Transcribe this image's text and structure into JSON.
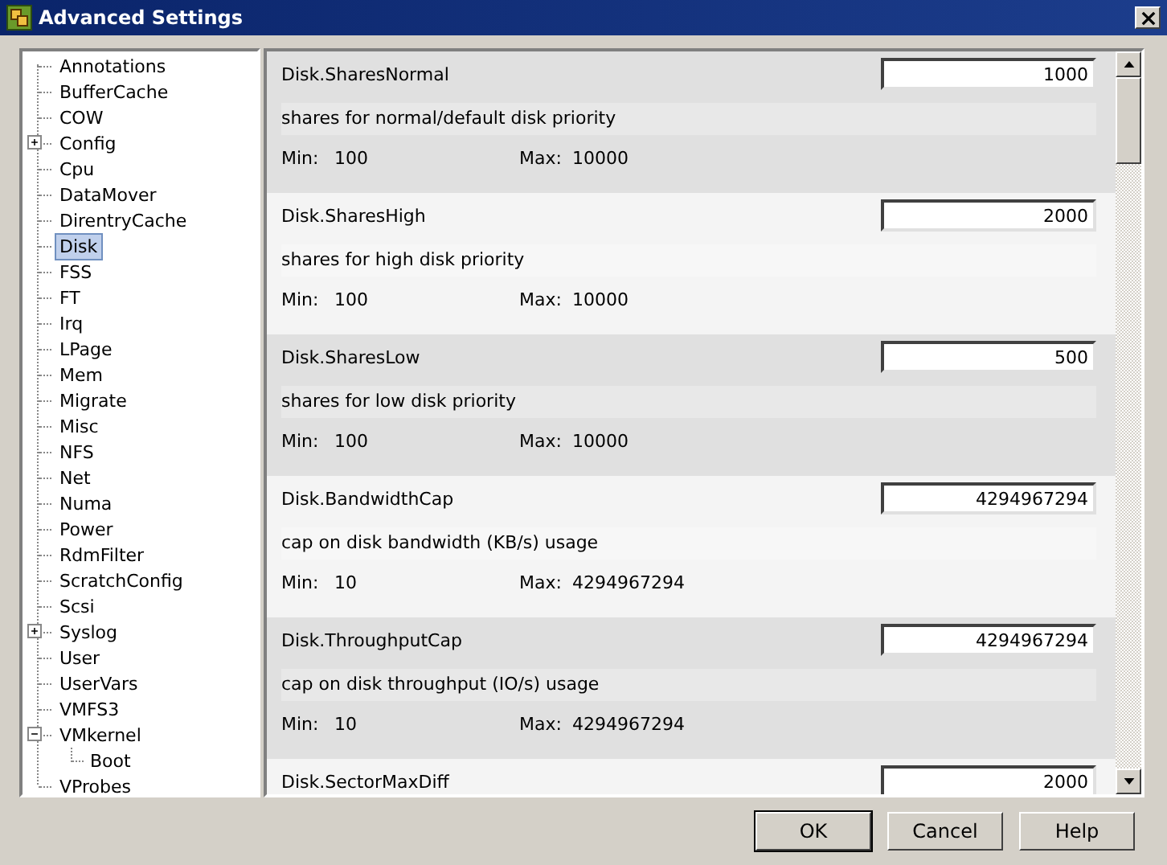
{
  "window": {
    "title": "Advanced Settings"
  },
  "tree": [
    {
      "label": "Annotations",
      "selected": false
    },
    {
      "label": "BufferCache",
      "selected": false
    },
    {
      "label": "COW",
      "selected": false
    },
    {
      "label": "Config",
      "selected": false,
      "expanded": false
    },
    {
      "label": "Cpu",
      "selected": false
    },
    {
      "label": "DataMover",
      "selected": false
    },
    {
      "label": "DirentryCache",
      "selected": false
    },
    {
      "label": "Disk",
      "selected": true
    },
    {
      "label": "FSS",
      "selected": false
    },
    {
      "label": "FT",
      "selected": false
    },
    {
      "label": "Irq",
      "selected": false
    },
    {
      "label": "LPage",
      "selected": false
    },
    {
      "label": "Mem",
      "selected": false
    },
    {
      "label": "Migrate",
      "selected": false
    },
    {
      "label": "Misc",
      "selected": false
    },
    {
      "label": "NFS",
      "selected": false
    },
    {
      "label": "Net",
      "selected": false
    },
    {
      "label": "Numa",
      "selected": false
    },
    {
      "label": "Power",
      "selected": false
    },
    {
      "label": "RdmFilter",
      "selected": false
    },
    {
      "label": "ScratchConfig",
      "selected": false
    },
    {
      "label": "Scsi",
      "selected": false
    },
    {
      "label": "Syslog",
      "selected": false,
      "expanded": false
    },
    {
      "label": "User",
      "selected": false
    },
    {
      "label": "UserVars",
      "selected": false
    },
    {
      "label": "VMFS3",
      "selected": false
    },
    {
      "label": "VMkernel",
      "selected": false,
      "expanded": true,
      "children": [
        {
          "label": "Boot",
          "selected": false
        }
      ]
    },
    {
      "label": "VProbes",
      "selected": false
    }
  ],
  "settings": [
    {
      "name": "Disk.SharesNormal",
      "value": "1000",
      "description": "shares for normal/default disk priority",
      "min_label": "Min:",
      "min": "100",
      "max_label": "Max:",
      "max": "10000"
    },
    {
      "name": "Disk.SharesHigh",
      "value": "2000",
      "description": "shares for high disk priority",
      "min_label": "Min:",
      "min": "100",
      "max_label": "Max:",
      "max": "10000"
    },
    {
      "name": "Disk.SharesLow",
      "value": "500",
      "description": "shares for low disk priority",
      "min_label": "Min:",
      "min": "100",
      "max_label": "Max:",
      "max": "10000"
    },
    {
      "name": "Disk.BandwidthCap",
      "value": "4294967294",
      "description": "cap on disk bandwidth (KB/s) usage",
      "min_label": "Min:",
      "min": "10",
      "max_label": "Max:",
      "max": "4294967294"
    },
    {
      "name": "Disk.ThroughputCap",
      "value": "4294967294",
      "description": "cap on disk throughput (IO/s) usage",
      "min_label": "Min:",
      "min": "10",
      "max_label": "Max:",
      "max": "4294967294"
    },
    {
      "name": "Disk.SectorMaxDiff",
      "value": "2000"
    }
  ],
  "buttons": [
    {
      "label": "OK",
      "default": true
    },
    {
      "label": "Cancel",
      "default": false
    },
    {
      "label": "Help",
      "default": false
    }
  ]
}
